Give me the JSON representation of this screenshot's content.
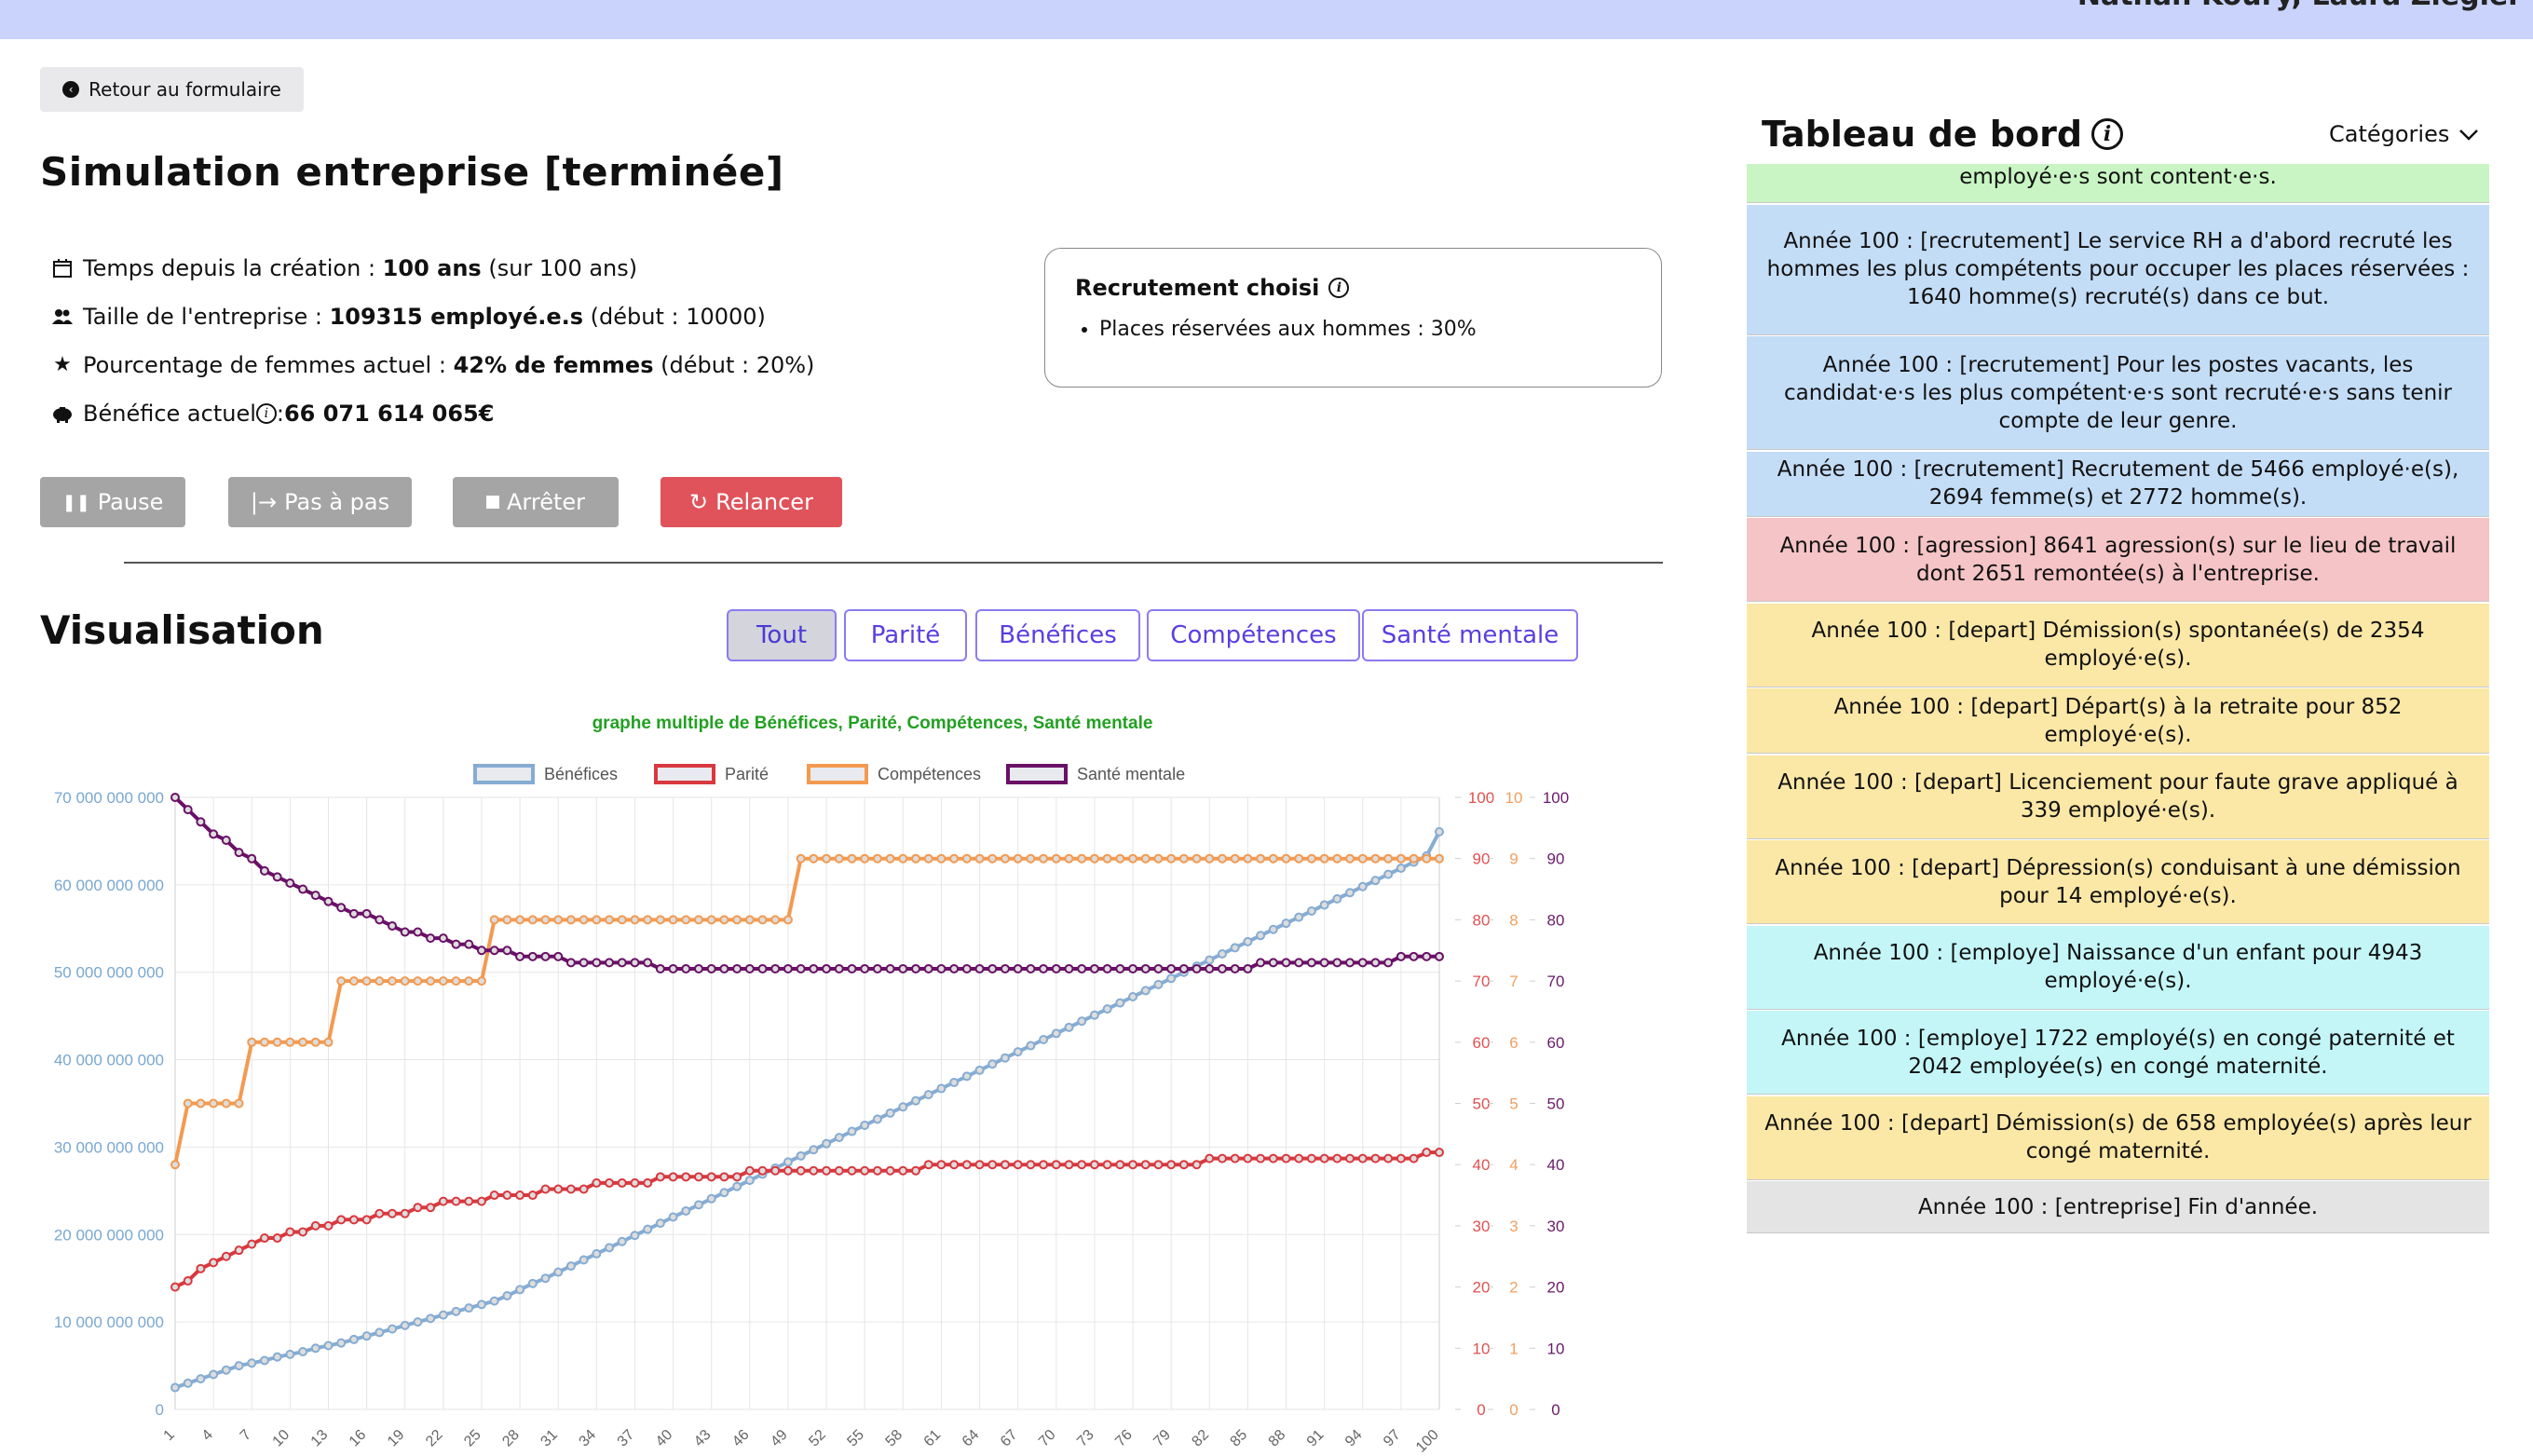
{
  "header": {
    "authors": "Nathan Koury, Laura Ziegler"
  },
  "back_button": {
    "label": "Retour au formulaire"
  },
  "title": "Simulation entreprise [terminée]",
  "stats": {
    "time_label": "Temps depuis la création : ",
    "time_value": "100 ans",
    "time_suffix": " (sur 100 ans)",
    "size_label": "Taille de l'entreprise : ",
    "size_value": "109315 employé.e.s",
    "size_suffix": " (début : 10000)",
    "women_label": "Pourcentage de femmes actuel : ",
    "women_value": "42% de femmes",
    "women_suffix": " (début : 20%)",
    "profit_label": "Bénéfice actuel ",
    "profit_sep": " : ",
    "profit_value": "66 071 614 065€"
  },
  "recruitment": {
    "title": "Recrutement choisi",
    "item": "Places réservées aux hommes : 30%"
  },
  "controls": {
    "pause": "Pause",
    "step": "Pas à pas",
    "stop": "Arrêter",
    "restart": "Relancer"
  },
  "visualisation": {
    "title": "Visualisation",
    "tabs": [
      "Tout",
      "Parité",
      "Bénéfices",
      "Compétences",
      "Santé mentale"
    ]
  },
  "dashboard": {
    "title": "Tableau de bord",
    "category_select": "Catégories",
    "events": [
      {
        "text": "employé·e·s sont content·e·s.",
        "color": "#c8f5c3"
      },
      {
        "text": "Année 100 : [recrutement] Le service RH a d'abord recruté les hommes les plus compétents pour occuper les places réservées : 1640 homme(s) recruté(s) dans ce but.",
        "color": "#c4ddf6"
      },
      {
        "text": "Année 100 : [recrutement] Pour les postes vacants, les candidat·e·s les plus compétent·e·s sont recruté·e·s sans tenir compte de leur genre.",
        "color": "#c4ddf6"
      },
      {
        "text": "Année 100 : [recrutement] Recrutement de 5466 employé·e(s), 2694 femme(s) et 2772 homme(s).",
        "color": "#c4ddf6"
      },
      {
        "text": "Année 100 : [agression] 8641 agression(s) sur le lieu de travail dont 2651 remontée(s) à l'entreprise.",
        "color": "#f5c4c6"
      },
      {
        "text": "Année 100 : [depart] Démission(s) spontanée(s) de 2354 employé·e(s).",
        "color": "#fbe8a6"
      },
      {
        "text": "Année 100 : [depart] Départ(s) à la retraite pour 852 employé·e(s).",
        "color": "#fbe8a6"
      },
      {
        "text": "Année 100 : [depart] Licenciement pour faute grave appliqué à 339 employé·e(s).",
        "color": "#fbe8a6"
      },
      {
        "text": "Année 100 : [depart] Dépression(s) conduisant à une démission pour 14 employé·e(s).",
        "color": "#fbe8a6"
      },
      {
        "text": "Année 100 : [employe] Naissance d'un enfant pour 4943 employé·e(s).",
        "color": "#c4f6f8"
      },
      {
        "text": "Année 100 : [employe] 1722 employé(s) en congé paternité et 2042 employée(s) en congé maternité.",
        "color": "#c4f6f8"
      },
      {
        "text": "Année 100 : [depart] Démission(s) de 658 employée(s) après leur congé maternité.",
        "color": "#fbe8a6"
      },
      {
        "text": "Année 100 : [entreprise] Fin d'année.",
        "color": "#e4e4e4"
      }
    ]
  },
  "chart_data": {
    "type": "line",
    "title": "graphe multiple de Bénéfices, Parité, Compétences, Santé mentale",
    "title_color": "#22a022",
    "x_start": 1,
    "x_end": 100,
    "x_tick_labels": [
      "1",
      "4",
      "7",
      "10",
      "13",
      "16",
      "19",
      "22",
      "25",
      "28",
      "31",
      "34",
      "37",
      "40",
      "43",
      "46",
      "49",
      "52",
      "55",
      "58",
      "61",
      "64",
      "67",
      "70",
      "73",
      "76",
      "79",
      "82",
      "85",
      "88",
      "91",
      "94",
      "97",
      "100"
    ],
    "axes": {
      "y_left": {
        "min": 0,
        "max": 70000000000,
        "ticks": [
          "0",
          "10 000 000 000",
          "20 000 000 000",
          "30 000 000 000",
          "40 000 000 000",
          "50 000 000 000",
          "60 000 000 000",
          "70 000 000 000"
        ],
        "color": "#7aa7d0"
      },
      "y_parite": {
        "min": 0,
        "max": 100,
        "ticks": [
          "0",
          "10",
          "20",
          "30",
          "40",
          "50",
          "60",
          "70",
          "80",
          "90",
          "100"
        ],
        "color": "#e05050"
      },
      "y_competences": {
        "min": 0,
        "max": 10,
        "ticks": [
          "0",
          "1",
          "2",
          "3",
          "4",
          "5",
          "6",
          "7",
          "8",
          "9",
          "10"
        ],
        "color": "#f0a060"
      },
      "y_sante": {
        "min": 0,
        "max": 100,
        "ticks": [
          "0",
          "10",
          "20",
          "30",
          "40",
          "50",
          "60",
          "70",
          "80",
          "90",
          "100"
        ],
        "color": "#6a1b6a"
      }
    },
    "grid": true,
    "legend_position": "top",
    "series": [
      {
        "name": "Bénéfices",
        "axis": "y_left",
        "color": "#86acd2",
        "values": [
          2500000000,
          3000000000,
          3500000000,
          4000000000,
          4500000000,
          5000000000,
          5300000000,
          5600000000,
          6000000000,
          6300000000,
          6600000000,
          7000000000,
          7300000000,
          7600000000,
          8000000000,
          8400000000,
          8800000000,
          9200000000,
          9600000000,
          10000000000,
          10400000000,
          10800000000,
          11200000000,
          11600000000,
          12000000000,
          12400000000,
          13000000000,
          13700000000,
          14400000000,
          15000000000,
          15700000000,
          16400000000,
          17100000000,
          17800000000,
          18500000000,
          19200000000,
          19900000000,
          20600000000,
          21300000000,
          22000000000,
          22700000000,
          23400000000,
          24100000000,
          24800000000,
          25500000000,
          26200000000,
          26900000000,
          27600000000,
          28300000000,
          29000000000,
          29700000000,
          30400000000,
          31100000000,
          31800000000,
          32500000000,
          33200000000,
          33900000000,
          34600000000,
          35300000000,
          36000000000,
          36700000000,
          37400000000,
          38100000000,
          38800000000,
          39500000000,
          40200000000,
          40900000000,
          41600000000,
          42300000000,
          43000000000,
          43700000000,
          44400000000,
          45100000000,
          45800000000,
          46500000000,
          47200000000,
          47900000000,
          48600000000,
          49300000000,
          50000000000,
          50700000000,
          51400000000,
          52100000000,
          52800000000,
          53500000000,
          54200000000,
          54900000000,
          55600000000,
          56300000000,
          57000000000,
          57700000000,
          58400000000,
          59100000000,
          59800000000,
          60500000000,
          61200000000,
          61900000000,
          62600000000,
          63300000000,
          66071614065
        ]
      },
      {
        "name": "Parité",
        "axis": "y_parite",
        "color": "#d9383f",
        "values": [
          20,
          21,
          23,
          24,
          25,
          26,
          27,
          28,
          28,
          29,
          29,
          30,
          30,
          31,
          31,
          31,
          32,
          32,
          32,
          33,
          33,
          34,
          34,
          34,
          34,
          35,
          35,
          35,
          35,
          36,
          36,
          36,
          36,
          37,
          37,
          37,
          37,
          37,
          38,
          38,
          38,
          38,
          38,
          38,
          38,
          39,
          39,
          39,
          39,
          39,
          39,
          39,
          39,
          39,
          39,
          39,
          39,
          39,
          39,
          40,
          40,
          40,
          40,
          40,
          40,
          40,
          40,
          40,
          40,
          40,
          40,
          40,
          40,
          40,
          40,
          40,
          40,
          40,
          40,
          40,
          40,
          41,
          41,
          41,
          41,
          41,
          41,
          41,
          41,
          41,
          41,
          41,
          41,
          41,
          41,
          41,
          41,
          41,
          42,
          42
        ]
      },
      {
        "name": "Compétences",
        "axis": "y_competences",
        "color": "#f39a50",
        "values": [
          4,
          5,
          5,
          5,
          5,
          5,
          6,
          6,
          6,
          6,
          6,
          6,
          6,
          7,
          7,
          7,
          7,
          7,
          7,
          7,
          7,
          7,
          7,
          7,
          7,
          8,
          8,
          8,
          8,
          8,
          8,
          8,
          8,
          8,
          8,
          8,
          8,
          8,
          8,
          8,
          8,
          8,
          8,
          8,
          8,
          8,
          8,
          8,
          8,
          9,
          9,
          9,
          9,
          9,
          9,
          9,
          9,
          9,
          9,
          9,
          9,
          9,
          9,
          9,
          9,
          9,
          9,
          9,
          9,
          9,
          9,
          9,
          9,
          9,
          9,
          9,
          9,
          9,
          9,
          9,
          9,
          9,
          9,
          9,
          9,
          9,
          9,
          9,
          9,
          9,
          9,
          9,
          9,
          9,
          9,
          9,
          9,
          9,
          9,
          9
        ]
      },
      {
        "name": "Santé mentale",
        "axis": "y_sante",
        "color": "#6a1066",
        "values": [
          100,
          98,
          96,
          94,
          93,
          91,
          90,
          88,
          87,
          86,
          85,
          84,
          83,
          82,
          81,
          81,
          80,
          79,
          78,
          78,
          77,
          77,
          76,
          76,
          75,
          75,
          75,
          74,
          74,
          74,
          74,
          73,
          73,
          73,
          73,
          73,
          73,
          73,
          72,
          72,
          72,
          72,
          72,
          72,
          72,
          72,
          72,
          72,
          72,
          72,
          72,
          72,
          72,
          72,
          72,
          72,
          72,
          72,
          72,
          72,
          72,
          72,
          72,
          72,
          72,
          72,
          72,
          72,
          72,
          72,
          72,
          72,
          72,
          72,
          72,
          72,
          72,
          72,
          72,
          72,
          72,
          72,
          72,
          72,
          72,
          73,
          73,
          73,
          73,
          73,
          73,
          73,
          73,
          73,
          73,
          73,
          74,
          74,
          74,
          74
        ]
      }
    ]
  }
}
